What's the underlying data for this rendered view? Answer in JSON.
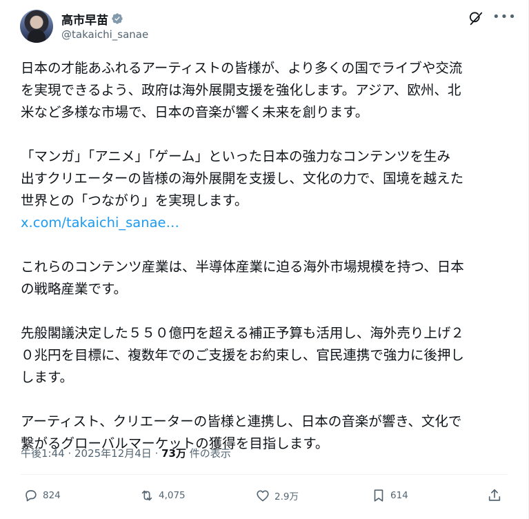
{
  "author": {
    "name": "高市早苗",
    "handle": "@takaichi_sanae",
    "verified_icon": "verified-badge-icon"
  },
  "header_icons": {
    "grok": "grok-icon",
    "more": "more-icon"
  },
  "body": {
    "p1": "日本の才能あふれるアーティストの皆様が、より多くの国でライブや交流\nを実現できるよう、政府は海外展開支援を強化します。アジア、欧州、北\n米など多様な市場で、日本の音楽が響く未来を創ります。",
    "p2": "「マンガ」「アニメ」「ゲーム」といった日本の強力なコンテンツを生み\n出すクリエーターの皆様の海外展開を支援し、文化の力で、国境を越えた\n世界との「つながり」を実現します。",
    "link": "x.com/takaichi_sanae…",
    "p3": "これらのコンテンツ産業は、半導体産業に迫る海外市場規模を持つ、日本\nの戦略産業です。",
    "p4": "先般閣議決定した５５０億円を超える補正予算も活用し、海外売り上げ２\n０兆円を目標に、複数年でのご支援をお約束し、官民連携で強力に後押し\nします。",
    "p5": "アーティスト、クリエーターの皆様と連携し、日本の音楽が響き、文化で\n繋がるグローバルマーケットの獲得を目指します。"
  },
  "meta": {
    "time": "午後1:44",
    "sep": " · ",
    "date": "2025年12月4日",
    "views": "73万",
    "views_label": " 件の表示"
  },
  "actions": {
    "reply": {
      "icon": "reply-icon",
      "count": "824"
    },
    "repost": {
      "icon": "repost-icon",
      "count": "4,075"
    },
    "like": {
      "icon": "heart-icon",
      "count": "2.9万"
    },
    "bookmark": {
      "icon": "bookmark-icon",
      "count": "614"
    },
    "share": {
      "icon": "share-icon"
    }
  },
  "colors": {
    "link": "#1d9bf0",
    "verified": "#829aab",
    "secondary_text": "#536471"
  }
}
